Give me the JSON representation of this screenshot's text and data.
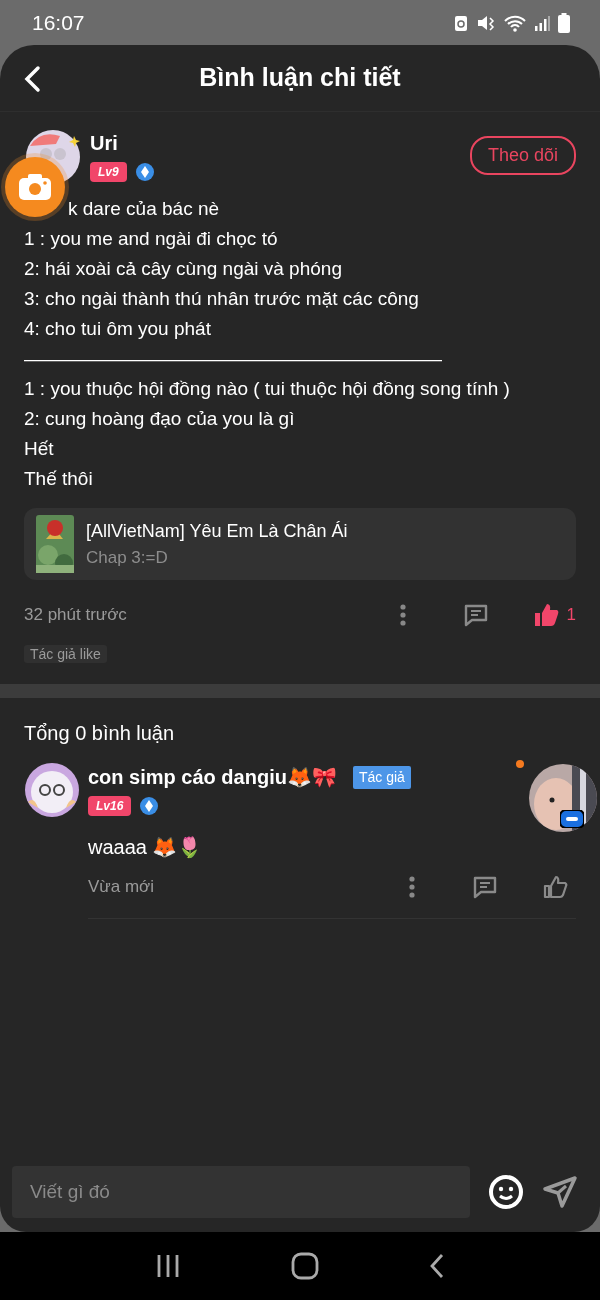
{
  "status_bar": {
    "time": "16:07"
  },
  "header": {
    "title": "Bình luận chi tiết"
  },
  "post": {
    "author": "Uri",
    "level": "Lv9",
    "follow_button": "Theo dõi",
    "lines": [
      "k dare của bác nè",
      "1 : you me and ngài đi chọc tó",
      "2: hái xoài cả cây cùng ngài và phóng",
      "3: cho ngài thành thú nhân trước mặt các công",
      "4: cho tui ôm you phát",
      "——————————————————————",
      "1 : you thuộc hội đồng nào ( tui thuộc hội đồng song tính )",
      "2: cung hoàng đạo của you là gì",
      "Hết",
      "Thế thôi"
    ],
    "linked_story": {
      "title": "[AllVietNam] Yêu Em Là Chân Ái",
      "chapter": "Chap 3:=D"
    },
    "time": "32 phút trước",
    "liked": true,
    "like_count": "1",
    "tag": "Tác giả like"
  },
  "replies_header": "Tổng 0 bình luận",
  "replies": [
    {
      "author": "con simp cáo dangiu🦊🎀",
      "badge": "Tác giả",
      "level": "Lv16",
      "text": "waaaa 🦊🌷",
      "time": "Vừa mới",
      "liked": false
    }
  ],
  "composer": {
    "placeholder": "Viết gì đó"
  }
}
